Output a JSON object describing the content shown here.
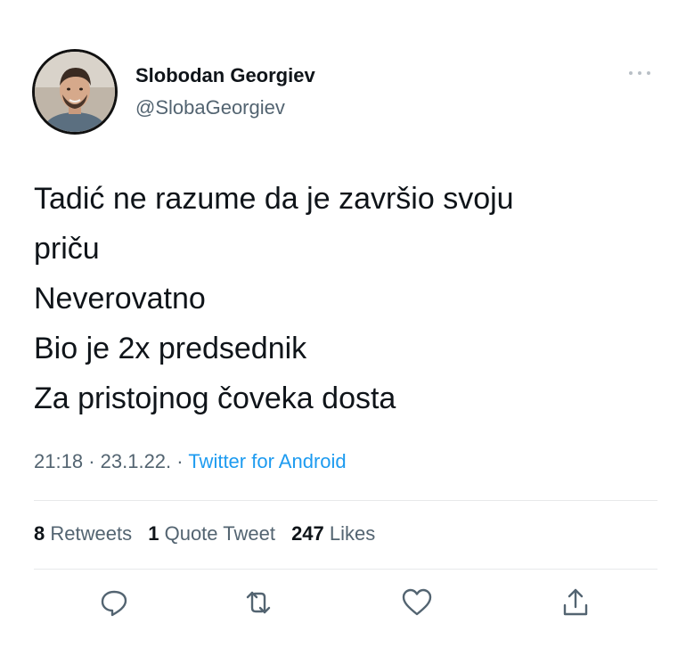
{
  "author": {
    "name": "Slobodan Georgiev",
    "handle": "@SlobaGeorgiev",
    "avatar_icon": "avatar-photo"
  },
  "tweet": {
    "lines": [
      "Tadić ne razume da je završio svoju",
      "priču",
      "Neverovatno",
      "Bio je 2x predsednik",
      "Za pristojnog čoveka dosta"
    ],
    "time": "21:18",
    "date": "23.1.22.",
    "separator": "·",
    "source": "Twitter for Android"
  },
  "stats": {
    "retweets_count": "8",
    "retweets_label": "Retweets",
    "quotes_count": "1",
    "quotes_label": "Quote Tweet",
    "likes_count": "247",
    "likes_label": "Likes"
  },
  "actions": {
    "reply_icon": "reply-icon",
    "retweet_icon": "retweet-icon",
    "like_icon": "like-icon",
    "share_icon": "share-icon"
  },
  "colors": {
    "text": "#0f1419",
    "secondary": "#536471",
    "link": "#1d9bf0",
    "divider": "#e7e9ea"
  }
}
